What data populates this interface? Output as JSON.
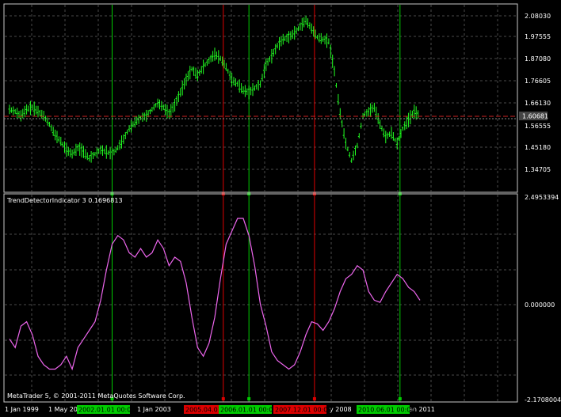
{
  "colors": {
    "background": "#000000",
    "grid": "#4a4a4a",
    "frame": "#c8c8c8",
    "price_series": "#22ff22",
    "indicator_series": "#ee66ee",
    "bid_line": "#cc2222",
    "ask_line": "#888888",
    "signal_up": "#00cc00",
    "signal_down": "#dd0000",
    "text": "#ffffff"
  },
  "price_axis": {
    "labels": [
      "2.08030",
      "1.97555",
      "1.87080",
      "1.76605",
      "1.66130",
      "1.56555",
      "1.45180",
      "1.34705"
    ],
    "current_price": "1.60681"
  },
  "indicator": {
    "title": "TrendDetectorIndicator 3 0.1696813",
    "axis_labels": [
      "2.4953394",
      "0.000000",
      "-2.1708004"
    ]
  },
  "time_axis": {
    "labels": [
      "1 Jan 1999",
      "1 May 20",
      "1 Jan 2003",
      "y 2008",
      "an 2011"
    ],
    "signal_tags": [
      {
        "text": "2002.01.01 00:00",
        "kind": "up"
      },
      {
        "text": "2005.04.01 00:00",
        "kind": "down"
      },
      {
        "text": "2006.01.01 00:00",
        "kind": "up"
      },
      {
        "text": "2007.12.01 00:00",
        "kind": "down"
      },
      {
        "text": "2010.06.01 00:00",
        "kind": "up"
      }
    ]
  },
  "copyright": "MetaTrader 5, © 2001-2011 MetaQuotes Software Corp.",
  "chart_data": [
    {
      "type": "line",
      "series": [
        {
          "x": [
            "1999-01",
            "1999-03",
            "1999-05",
            "1999-07",
            "1999-09",
            "1999-11",
            "2000-01",
            "2000-03",
            "2000-05",
            "2000-07",
            "2000-09",
            "2000-11",
            "2001-01",
            "2001-03",
            "2001-05",
            "2001-07",
            "2001-09",
            "2001-11",
            "2002-01",
            "2002-03",
            "2002-05",
            "2002-07",
            "2002-09",
            "2002-11",
            "2003-01",
            "2003-03",
            "2003-05",
            "2003-07",
            "2003-09",
            "2003-11",
            "2004-01",
            "2004-03",
            "2004-05",
            "2004-07",
            "2004-09",
            "2004-11",
            "2005-01",
            "2005-03",
            "2005-05",
            "2005-07",
            "2005-09",
            "2005-11",
            "2006-01",
            "2006-03",
            "2006-05",
            "2006-07",
            "2006-09",
            "2006-11",
            "2007-01",
            "2007-03",
            "2007-05",
            "2007-07",
            "2007-09",
            "2007-11",
            "2008-01",
            "2008-03",
            "2008-05",
            "2008-07",
            "2008-09",
            "2008-11",
            "2009-01",
            "2009-03",
            "2009-05",
            "2009-07",
            "2009-09",
            "2009-11",
            "2010-01",
            "2010-03",
            "2010-05",
            "2010-07",
            "2010-09",
            "2010-11",
            "2011-01"
          ],
          "values": [
            1.64,
            1.63,
            1.61,
            1.64,
            1.65,
            1.63,
            1.61,
            1.57,
            1.52,
            1.49,
            1.45,
            1.43,
            1.46,
            1.44,
            1.41,
            1.43,
            1.45,
            1.44,
            1.43,
            1.46,
            1.5,
            1.55,
            1.58,
            1.6,
            1.61,
            1.64,
            1.67,
            1.65,
            1.62,
            1.66,
            1.72,
            1.78,
            1.83,
            1.8,
            1.84,
            1.87,
            1.9,
            1.88,
            1.84,
            1.78,
            1.76,
            1.73,
            1.72,
            1.74,
            1.76,
            1.85,
            1.89,
            1.94,
            1.97,
            1.98,
            2.0,
            2.03,
            2.06,
            2.02,
            1.98,
            1.97,
            1.96,
            1.82,
            1.62,
            1.48,
            1.4,
            1.47,
            1.61,
            1.63,
            1.65,
            1.57,
            1.51,
            1.53,
            1.48,
            1.55,
            1.59,
            1.63,
            1.61
          ]
        }
      ]
    },
    {
      "type": "line",
      "title": "TrendDetectorIndicator 3 0.1696813",
      "ylim": [
        -2.1708004,
        2.4953394
      ],
      "series": [
        {
          "x": [
            "1999-01",
            "1999-03",
            "1999-05",
            "1999-07",
            "1999-09",
            "1999-11",
            "2000-01",
            "2000-03",
            "2000-05",
            "2000-07",
            "2000-09",
            "2000-11",
            "2001-01",
            "2001-03",
            "2001-05",
            "2001-07",
            "2001-09",
            "2001-11",
            "2002-01",
            "2002-03",
            "2002-05",
            "2002-07",
            "2002-09",
            "2002-11",
            "2003-01",
            "2003-03",
            "2003-05",
            "2003-07",
            "2003-09",
            "2003-11",
            "2004-01",
            "2004-03",
            "2004-05",
            "2004-07",
            "2004-09",
            "2004-11",
            "2005-01",
            "2005-03",
            "2005-05",
            "2005-07",
            "2005-09",
            "2005-11",
            "2006-01",
            "2006-03",
            "2006-05",
            "2006-07",
            "2006-09",
            "2006-11",
            "2007-01",
            "2007-03",
            "2007-05",
            "2007-07",
            "2007-09",
            "2007-11",
            "2008-01",
            "2008-03",
            "2008-05",
            "2008-07",
            "2008-09",
            "2008-11",
            "2009-01",
            "2009-03",
            "2009-05",
            "2009-07",
            "2009-09",
            "2009-11",
            "2010-01",
            "2010-03",
            "2010-05",
            "2010-07",
            "2010-09",
            "2010-11",
            "2011-01"
          ],
          "values": [
            -0.8,
            -1.0,
            -0.5,
            -0.4,
            -0.7,
            -1.2,
            -1.4,
            -1.5,
            -1.5,
            -1.4,
            -1.2,
            -1.5,
            -1.0,
            -0.8,
            -0.6,
            -0.4,
            0.1,
            0.8,
            1.4,
            1.6,
            1.5,
            1.2,
            1.1,
            1.3,
            1.1,
            1.2,
            1.5,
            1.3,
            0.9,
            1.1,
            1.0,
            0.5,
            -0.3,
            -1.0,
            -1.2,
            -0.9,
            -0.3,
            0.6,
            1.4,
            1.7,
            2.0,
            2.0,
            1.6,
            0.9,
            0.0,
            -0.5,
            -1.1,
            -1.3,
            -1.4,
            -1.5,
            -1.4,
            -1.1,
            -0.7,
            -0.4,
            -0.45,
            -0.6,
            -0.4,
            -0.1,
            0.3,
            0.6,
            0.7,
            0.9,
            0.8,
            0.3,
            0.1,
            0.05,
            0.3,
            0.5,
            0.7,
            0.6,
            0.4,
            0.3,
            0.1
          ]
        }
      ]
    }
  ]
}
